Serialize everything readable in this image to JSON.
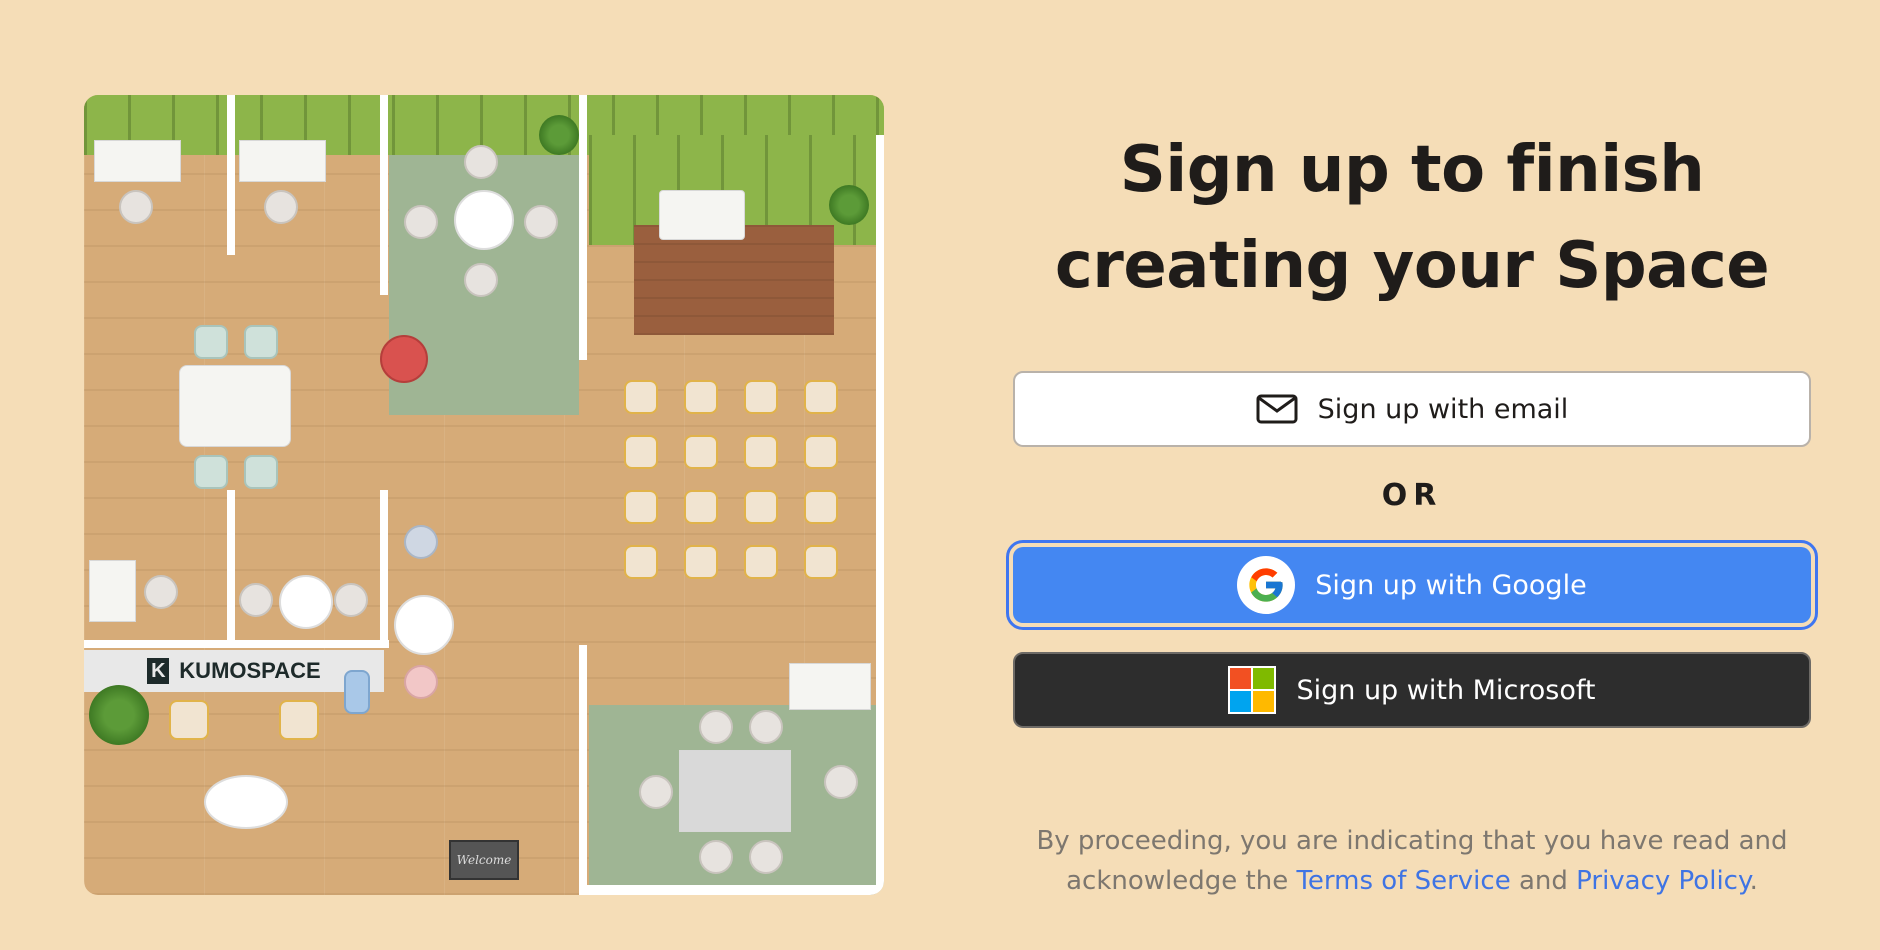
{
  "illustration": {
    "sign_text": "KUMOSPACE",
    "mat_text": "Welcome"
  },
  "signup": {
    "heading_line1": "Sign up to finish",
    "heading_line2": "creating your Space",
    "email_button": "Sign up with email",
    "or_separator": "OR",
    "google_button": "Sign up with Google",
    "microsoft_button": "Sign up with Microsoft",
    "legal_prefix": "By proceeding, you are indicating that you have read and acknowledge the ",
    "terms_link": "Terms of Service",
    "legal_and": " and ",
    "privacy_link": "Privacy Policy",
    "legal_suffix": "."
  },
  "colors": {
    "background": "#f5ddb7",
    "google_blue": "#4487f2",
    "microsoft_dark": "#2d2d2d",
    "link_blue": "#3f74e4"
  }
}
